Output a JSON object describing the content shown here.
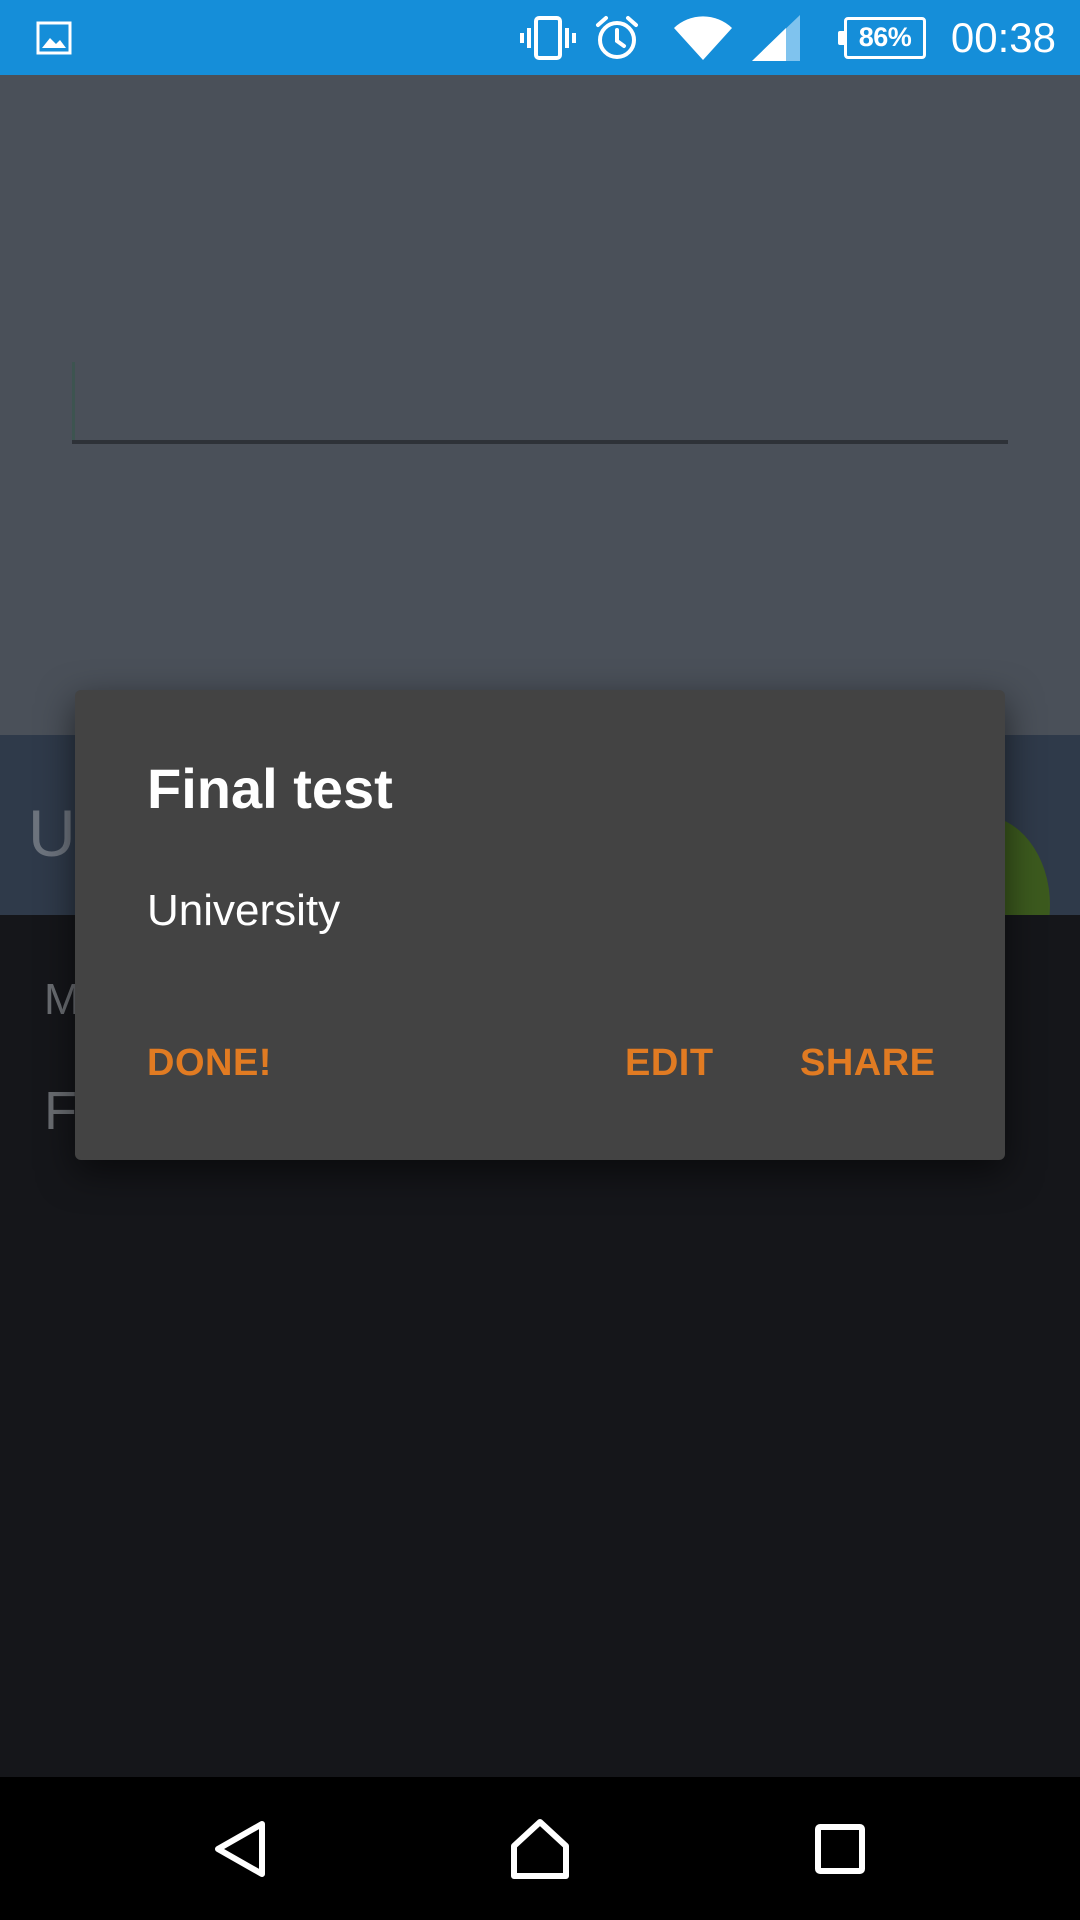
{
  "status_bar": {
    "battery": "86%",
    "time": "00:38",
    "icons": [
      "gallery-icon",
      "vibrate-icon",
      "alarm-icon",
      "wifi-icon",
      "signal-icon",
      "battery-icon"
    ]
  },
  "background": {
    "band_text": "U",
    "list_items": [
      "M",
      "F"
    ]
  },
  "dialog": {
    "title": "Final test",
    "message": "University",
    "buttons": {
      "done": "DONE!",
      "edit": "EDIT",
      "share": "SHARE"
    }
  },
  "colors": {
    "status_bar": "#158ed9",
    "dialog_bg": "#434343",
    "button_text": "#e17b22",
    "scrim_top": "#4a5059",
    "scrim_bottom": "#15161a"
  }
}
